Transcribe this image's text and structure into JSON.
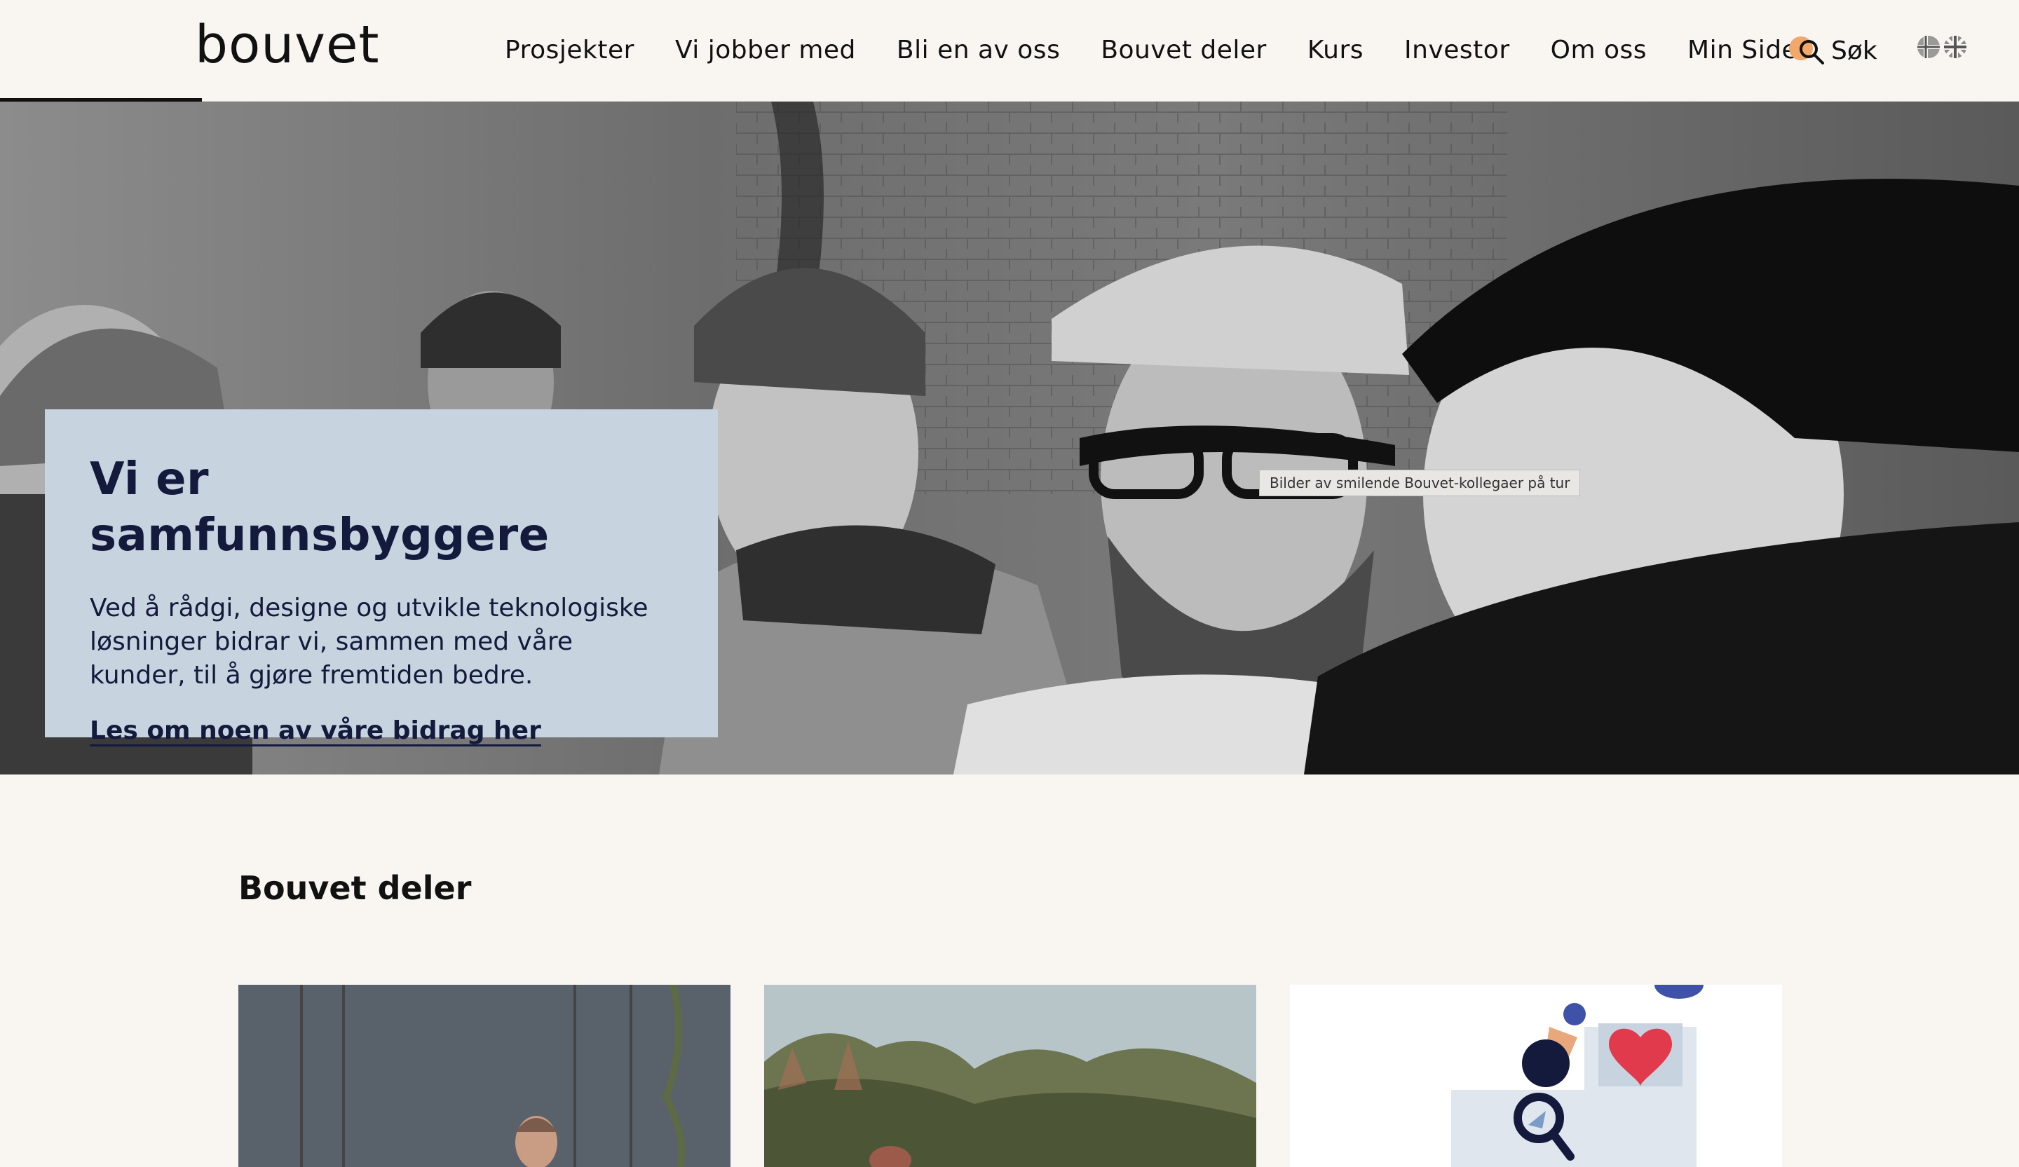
{
  "header": {
    "logo_text": "bouvet",
    "nav": [
      {
        "label": "Prosjekter"
      },
      {
        "label": "Vi jobber med"
      },
      {
        "label": "Bli en av oss"
      },
      {
        "label": "Bouvet deler"
      },
      {
        "label": "Kurs"
      },
      {
        "label": "Investor"
      },
      {
        "label": "Om oss"
      },
      {
        "label": "Min Side"
      }
    ],
    "search_label": "Søk",
    "language_icons": [
      "norway-flag-icon",
      "uk-flag-icon"
    ]
  },
  "hero": {
    "image_tooltip": "Bilder av smilende Bouvet-kollegaer på tur",
    "title": "Vi er samfunnsbyggere",
    "text": "Ved å rådgi, designe og utvikle teknologiske løsninger bidrar vi, sammen med våre kunder, til å gjøre fremtiden bedre.",
    "link": "Les om noen av våre bidrag her"
  },
  "section": {
    "title": "Bouvet deler"
  },
  "colors": {
    "background": "#f9f6f2",
    "hero_card": "#c7d4e0",
    "hero_text": "#141a3c",
    "search_accent": "#f1a86a"
  }
}
